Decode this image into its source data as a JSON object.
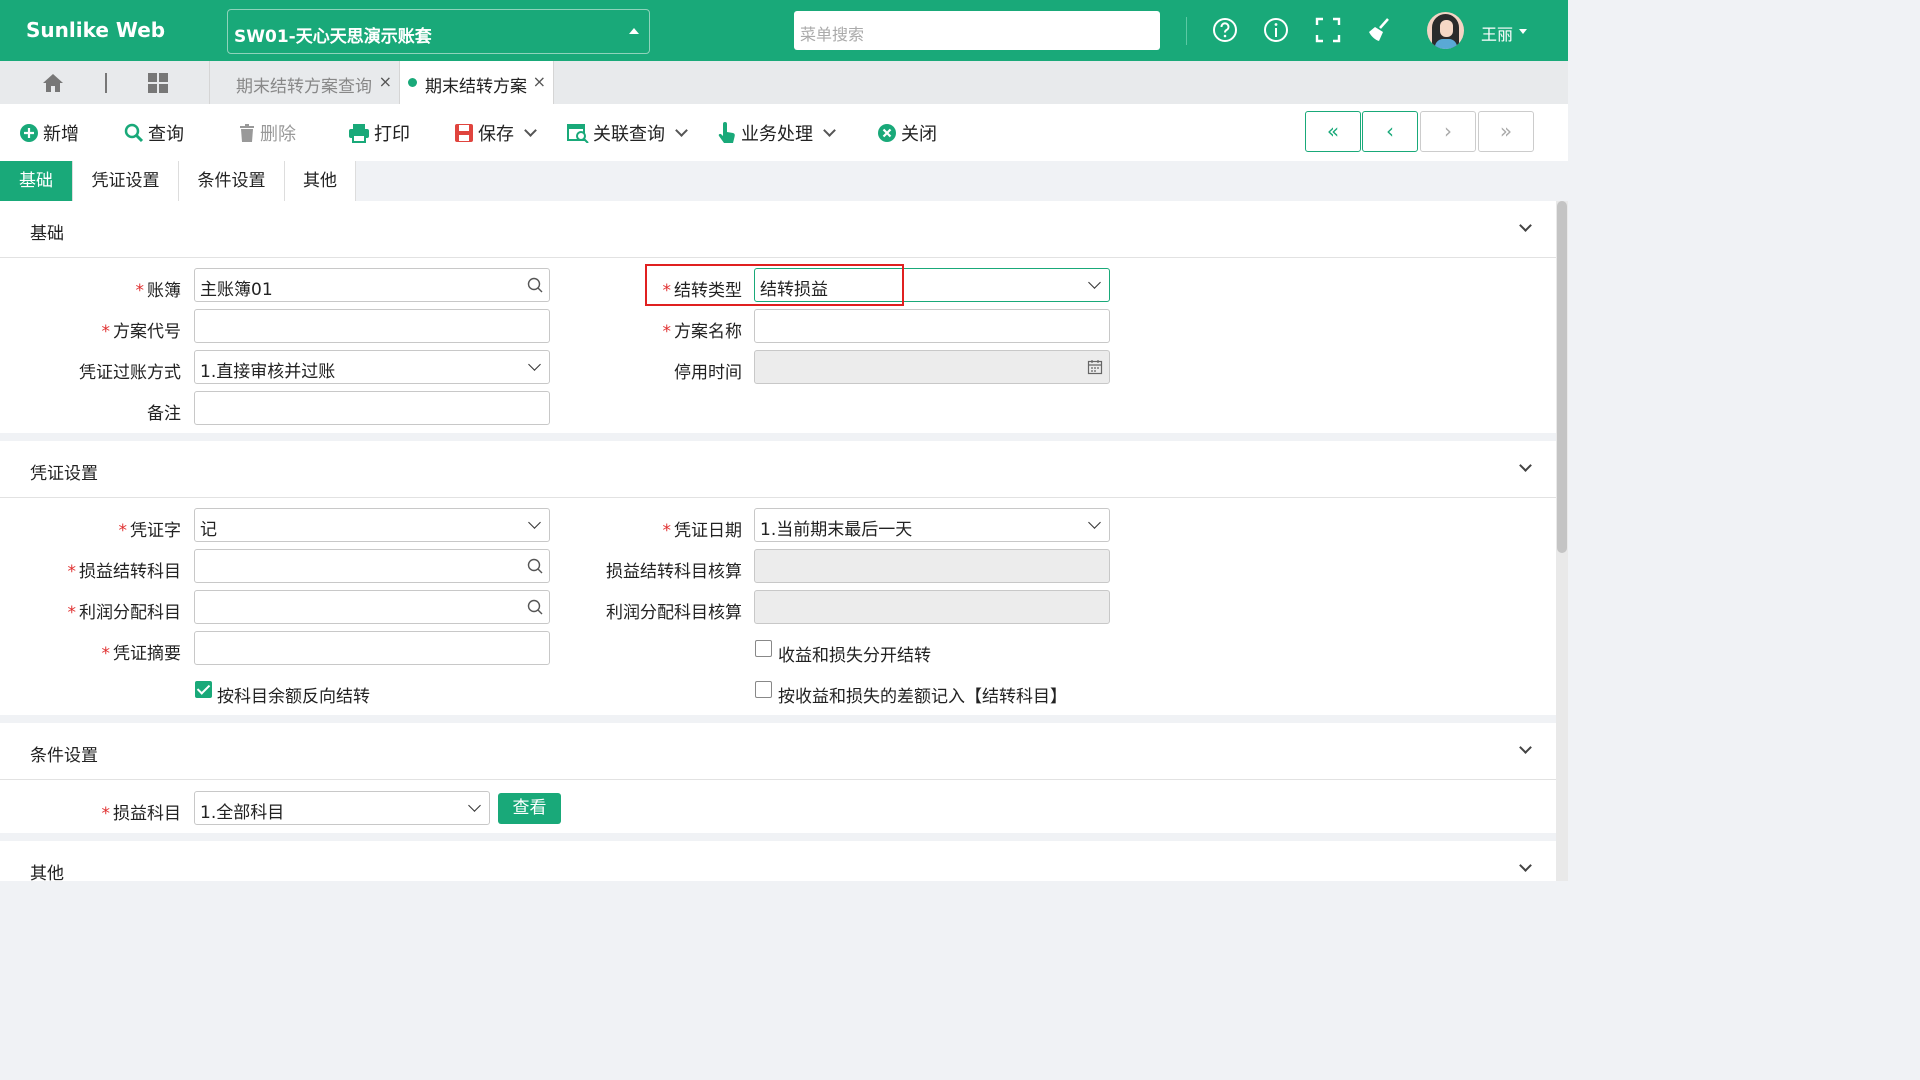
{
  "app": {
    "brand": "Sunlike Web",
    "account": "SW01-天心天思演示账套",
    "search_placeholder": "菜单搜索",
    "user": "王丽"
  },
  "tabs": [
    {
      "label": "期末结转方案查询",
      "active": false
    },
    {
      "label": "期末结转方案",
      "active": true
    }
  ],
  "toolbar": {
    "add": "新增",
    "query": "查询",
    "delete": "删除",
    "print": "打印",
    "save": "保存",
    "related_query": "关联查询",
    "business": "业务处理",
    "close": "关闭",
    "nav_first": "«",
    "nav_prev": "‹",
    "nav_next": "›",
    "nav_last": "»"
  },
  "form_tabs": [
    "基础",
    "凭证设置",
    "条件设置",
    "其他"
  ],
  "sections": {
    "basic": {
      "title": "基础",
      "ledger_label": "账簿",
      "ledger_value": "主账簿01",
      "type_label": "结转类型",
      "type_value": "结转损益",
      "code_label": "方案代号",
      "code_value": "",
      "name_label": "方案名称",
      "name_value": "",
      "posting_label": "凭证过账方式",
      "posting_value": "1.直接审核并过账",
      "stop_label": "停用时间",
      "stop_value": "",
      "remark_label": "备注",
      "remark_value": ""
    },
    "voucher": {
      "title": "凭证设置",
      "word_label": "凭证字",
      "word_value": "记",
      "date_label": "凭证日期",
      "date_value": "1.当前期末最后一天",
      "pl_acct_label": "损益结转科目",
      "pl_acct_value": "",
      "pl_audit_label": "损益结转科目核算",
      "pl_audit_value": "",
      "profit_label": "利润分配科目",
      "profit_value": "",
      "profit_audit_label": "利润分配科目核算",
      "profit_audit_value": "",
      "summary_label": "凭证摘要",
      "summary_value": "",
      "cb_separate": "收益和损失分开结转",
      "cb_reverse": "按科目余额反向结转",
      "cb_diff": "按收益和损失的差额记入【结转科目】"
    },
    "condition": {
      "title": "条件设置",
      "pl_label": "损益科目",
      "pl_value": "1.全部科目",
      "view": "查看"
    },
    "other": {
      "title": "其他"
    }
  },
  "colors": {
    "brand": "#19a979",
    "required": "#e03030",
    "highlight": "#e02020"
  }
}
